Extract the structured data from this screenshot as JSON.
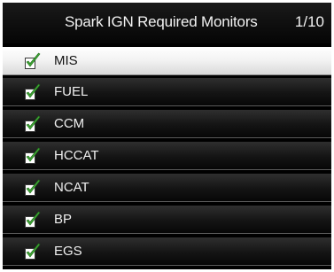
{
  "header": {
    "title": "Spark IGN Required Monitors",
    "page_indicator": "1/10"
  },
  "monitors": [
    {
      "label": "MIS",
      "icon": "checkbox-checked-icon",
      "selected": true
    },
    {
      "label": "FUEL",
      "icon": "checkbox-checked-icon",
      "selected": false
    },
    {
      "label": "CCM",
      "icon": "checkbox-checked-icon",
      "selected": false
    },
    {
      "label": "HCCAT",
      "icon": "checkbox-checked-icon",
      "selected": false
    },
    {
      "label": "NCAT",
      "icon": "checkbox-checked-icon",
      "selected": false
    },
    {
      "label": "BP",
      "icon": "checkbox-checked-icon",
      "selected": false
    },
    {
      "label": "EGS",
      "icon": "checkbox-checked-icon",
      "selected": false
    }
  ],
  "colors": {
    "check_green": "#3fa535",
    "header_bg": "#0a0a0a",
    "selected_row_bg": "#f2f2f2"
  }
}
